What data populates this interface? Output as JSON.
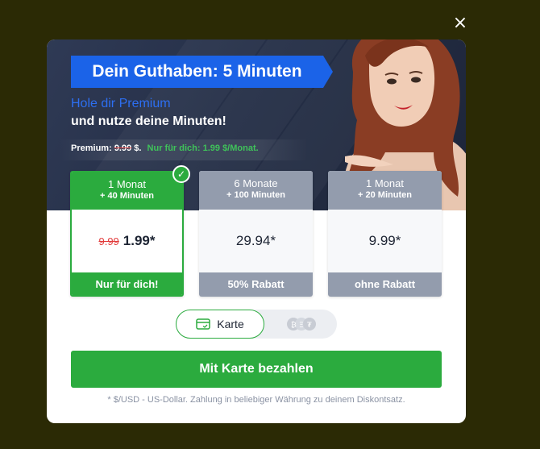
{
  "close": {
    "label": "×"
  },
  "header": {
    "title": "Dein Guthaben: 5 Minuten",
    "subtitle_line1": "Hole dir Premium",
    "subtitle_line2": "und nutze deine Minuten!",
    "promo_prefix": "Premium:",
    "promo_old_price": "9.99",
    "promo_currency": "$.",
    "promo_offer": "Nur für dich: 1.99 $/Monat."
  },
  "plans": [
    {
      "months": "1 Monat",
      "bonus": "+ 40 Minuten",
      "old_price": "9.99",
      "price": "1.99*",
      "footer": "Nur für dich!",
      "selected": true
    },
    {
      "months": "6 Monate",
      "bonus": "+ 100 Minuten",
      "price": "29.94*",
      "footer": "50% Rabatt",
      "selected": false
    },
    {
      "months": "1 Monat",
      "bonus": "+ 20 Minuten",
      "price": "9.99*",
      "footer": "ohne Rabatt",
      "selected": false
    }
  ],
  "payment": {
    "card_label": "Karte",
    "card_icon": "credit-card-icon",
    "crypto_icon": "crypto-coins-icon"
  },
  "pay_button": {
    "label": "Mit Karte bezahlen"
  },
  "footnote": "* $/USD - US-Dollar. Zahlung in beliebiger Währung zu deinem Diskontsatz.",
  "colors": {
    "backdrop": "#2b2a05",
    "brand_blue": "#1b63e8",
    "accent_green": "#2bab3e",
    "plan_gray": "#939cad",
    "hero_dark": "#252f47",
    "strike_red": "#e23b3b"
  }
}
